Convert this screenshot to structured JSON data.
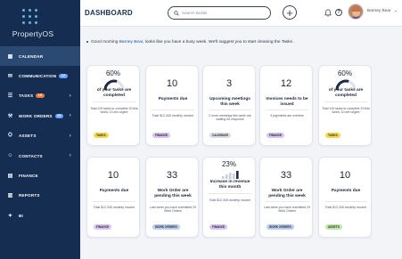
{
  "app": {
    "name": "PropertyOS"
  },
  "sidebar": {
    "items": [
      {
        "label": "CALENDAR",
        "icon": "calendar-icon",
        "active": true
      },
      {
        "label": "COMMUNICATION",
        "icon": "chat-icon",
        "badge": "12",
        "badge_color": "#6aa0ff"
      },
      {
        "label": "TASKS",
        "icon": "tasks-icon",
        "badge": "15",
        "badge_color": "#ef7a3c",
        "chevron": true
      },
      {
        "label": "WORK ORDERS",
        "icon": "wrench-icon",
        "badge": "20",
        "badge_color": "#6aa0ff",
        "chevron": true
      },
      {
        "label": "ASSETS",
        "icon": "assets-icon",
        "chevron": true
      },
      {
        "label": "CONTACTS",
        "icon": "contacts-icon",
        "chevron": true
      },
      {
        "label": "FINANCE",
        "icon": "finance-icon"
      },
      {
        "label": "REPORTS",
        "icon": "reports-icon"
      },
      {
        "label": "BI",
        "icon": "bulb-icon"
      }
    ]
  },
  "header": {
    "title": "DASHBOARD",
    "search_placeholder": "Search Builds",
    "add_label": "+",
    "help_label": "?",
    "user_name": "Barney Bear"
  },
  "greeting": {
    "prefix": "Good morning ",
    "name": "Barney Bear",
    "suffix": ", looks like you have a busy week. We'll suggest you to start cleaning the Tasks ."
  },
  "cards": [
    {
      "value": "60%",
      "type": "gauge",
      "gauge_fraction": 0.6,
      "label": "of your tasks are completed",
      "desc": "Total 100 tasks to complete 20 this week, 10 are urgent",
      "tag": "TASKS",
      "tag_color": "#f5d94a"
    },
    {
      "value": "10",
      "type": "number",
      "label": "Payments due",
      "desc": "Total $12,345 monthly income",
      "tag": "FINANCE",
      "tag_color": "#d7c4f2"
    },
    {
      "value": "3",
      "type": "number",
      "label": "Upcoming meetings this week",
      "desc": "2 more meetings this week are waiting for response",
      "tag": "CALENDAR",
      "tag_color": "#d9dde3"
    },
    {
      "value": "12",
      "type": "number",
      "label": "Invoices needs to be issued",
      "desc": "3 payments are overdue",
      "tag": "FINANCE",
      "tag_color": "#d7c4f2"
    },
    {
      "value": "60%",
      "type": "gauge",
      "gauge_fraction": 0.6,
      "label": "of your tasks are completed",
      "desc": "Total 100 tasks to complete 20 this week, 10 are urgent",
      "tag": "TASKS",
      "tag_color": "#f5d94a"
    },
    {
      "value": "10",
      "type": "number",
      "label": "Payments due",
      "desc": "Total $12,345 monthly income",
      "tag": "FINANCE",
      "tag_color": "#d7c4f2"
    },
    {
      "value": "33",
      "type": "number",
      "label": "Work Order are pending this week",
      "desc": "Last week you have submitted 29 Work Orders",
      "tag": "WORK ORDERS",
      "tag_color": "#b9ccef"
    },
    {
      "value": "23%",
      "type": "bars",
      "label": "Increase in revenue this month",
      "desc": "Total $12,345 monthly income",
      "tag": "FINANCE",
      "tag_color": "#d7c4f2"
    },
    {
      "value": "33",
      "type": "number",
      "label": "Work Order are pending this week",
      "desc": "Last week you have submitted 29 Work Orders",
      "tag": "WORK ORDERS",
      "tag_color": "#b9ccef"
    },
    {
      "value": "10",
      "type": "number",
      "label": "Payments due",
      "desc": "Total $12,345 monthly income",
      "tag": "ASSETS",
      "tag_color": "#bfe6a8"
    }
  ],
  "colors": {
    "sidebar": "#152d50",
    "accent": "#1d4f9a",
    "gauge": "#1e2b45"
  }
}
